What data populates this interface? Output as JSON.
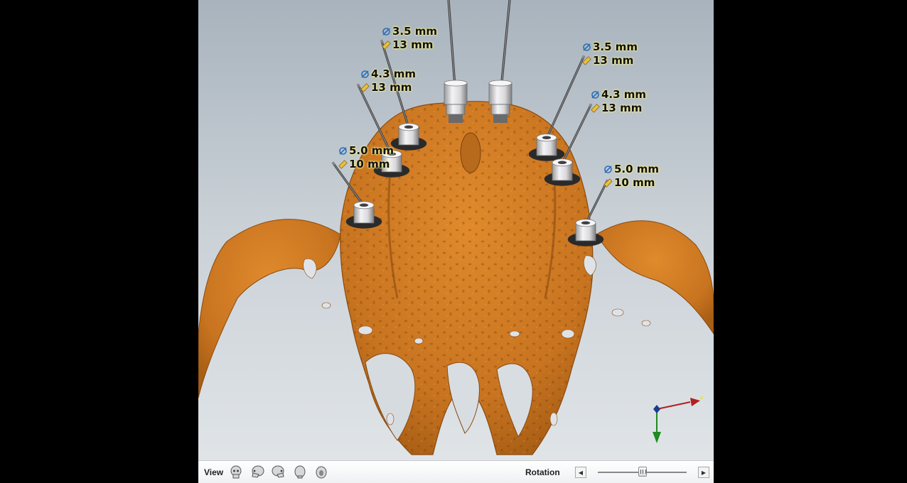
{
  "colors": {
    "bone": "#d07a22",
    "bone_dark": "#8a4a10",
    "implant_metal": "#e8e8ea",
    "axis_x": "#b02020",
    "axis_y": "#1f8a1f",
    "axis_z": "#1a3c8c"
  },
  "implants": [
    {
      "id": "left-molar",
      "diameter": "5.0 mm",
      "length": "10 mm"
    },
    {
      "id": "left-premolar",
      "diameter": "4.3 mm",
      "length": "13 mm"
    },
    {
      "id": "left-lateral",
      "diameter": "3.5 mm",
      "length": "13 mm"
    },
    {
      "id": "right-lateral",
      "diameter": "3.5 mm",
      "length": "13 mm"
    },
    {
      "id": "right-premolar",
      "diameter": "4.3 mm",
      "length": "13 mm"
    },
    {
      "id": "right-molar",
      "diameter": "5.0 mm",
      "length": "10 mm"
    }
  ],
  "toolbar": {
    "view_label": "View",
    "view_buttons": [
      "skull-front-icon",
      "skull-left-icon",
      "skull-right-icon",
      "skull-back-icon",
      "skull-top-icon"
    ],
    "rotation_label": "Rotation",
    "rotation_left": "◀",
    "rotation_right": "▶",
    "rotation_value": 0.5
  }
}
